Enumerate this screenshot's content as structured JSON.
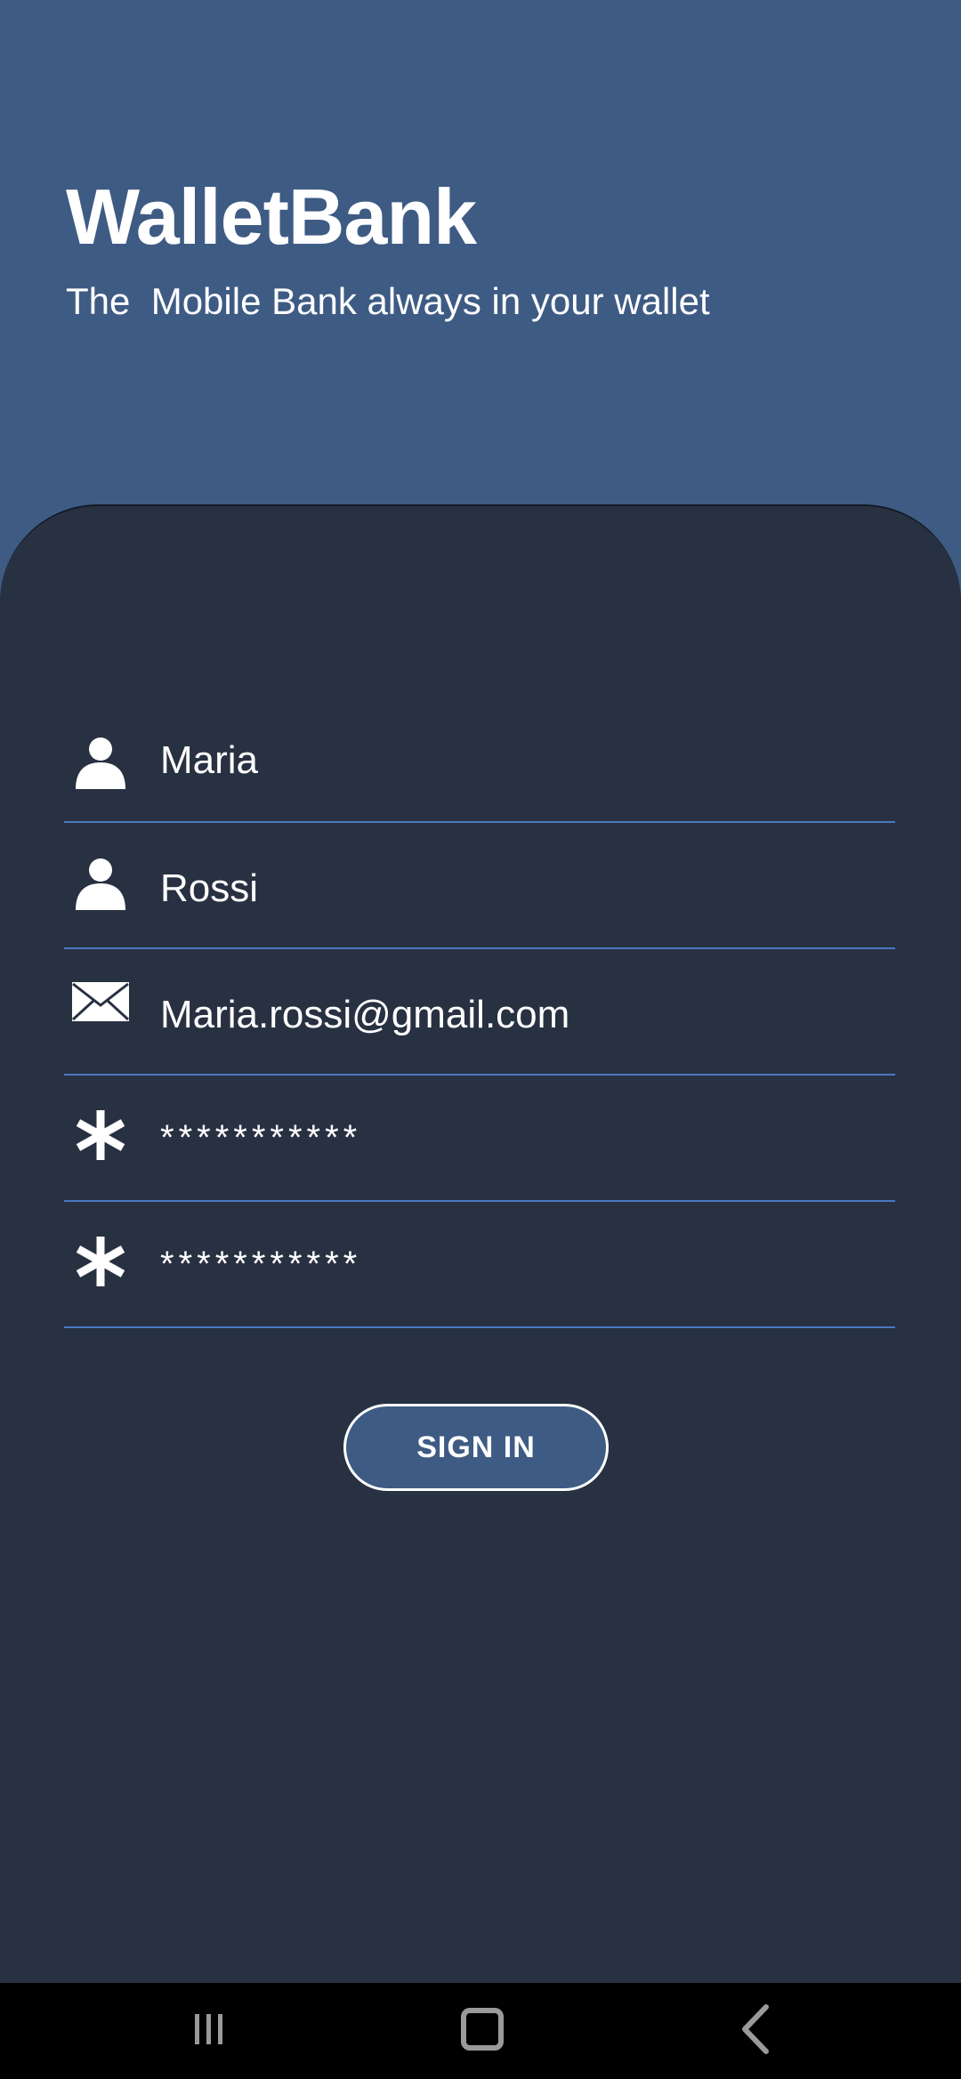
{
  "app": {
    "title": "WalletBank",
    "subtitle": "The  Mobile Bank always in your wallet"
  },
  "form": {
    "first_name": {
      "value": "Maria",
      "icon": "person-icon"
    },
    "last_name": {
      "value": "Rossi",
      "icon": "person-icon"
    },
    "email": {
      "value": "Maria.rossi@gmail.com",
      "icon": "envelope-icon"
    },
    "password": {
      "value": "***********",
      "icon": "asterisk-icon"
    },
    "confirm_password": {
      "value": "***********",
      "icon": "asterisk-icon"
    }
  },
  "actions": {
    "signin_label": "SIGN IN"
  },
  "navbar": {
    "recents_icon": "recents-icon",
    "home_icon": "home-icon",
    "back_icon": "back-icon"
  },
  "colors": {
    "header_bg": "#3e5b84",
    "card_bg": "#283141",
    "field_underline": "#4a78c4",
    "text": "#ffffff",
    "navbar_bg": "#000000"
  }
}
